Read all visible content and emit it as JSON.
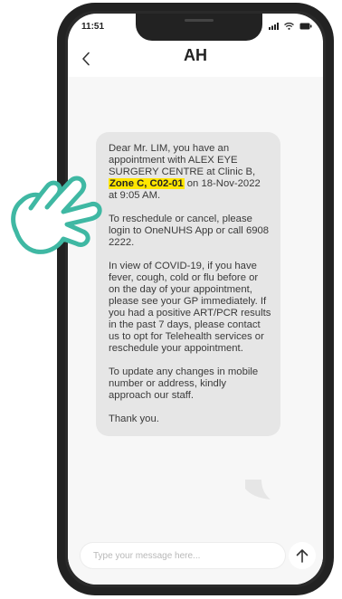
{
  "status_bar": {
    "time": "11:51",
    "icons": [
      "signal-icon",
      "wifi-icon",
      "battery-icon"
    ]
  },
  "header": {
    "back_icon": "chevron-left-icon",
    "contact_name": "AH"
  },
  "message": {
    "p1_pre": "Dear Mr. LIM, you have an appointment with ALEX EYE SURGERY CENTRE at Clinic B, ",
    "p1_highlight": "Zone C, C02-01",
    "p1_post": " on 18-Nov-2022 at 9:05 AM.",
    "p2": "To reschedule or cancel, please login to OneNUHS App or call 6908 2222.",
    "p3": "In view of COVID-19, if you have fever, cough, cold or flu before or on the day of your appointment, please see your GP immediately. If you had a positive ART/PCR results in the past 7 days, please contact us to opt for Telehealth services or reschedule your appointment.",
    "p4": "To update any changes in mobile number or address, kindly approach our staff.",
    "p5": "Thank you."
  },
  "composer": {
    "placeholder": "Type your message here...",
    "send_icon": "arrow-up-icon"
  },
  "overlay": {
    "hand_icon": "pointing-hand-icon"
  },
  "colors": {
    "highlight": "#ffe600",
    "bubble": "#e6e6e6",
    "hand": "#3fb8a3",
    "frame": "#222222"
  }
}
